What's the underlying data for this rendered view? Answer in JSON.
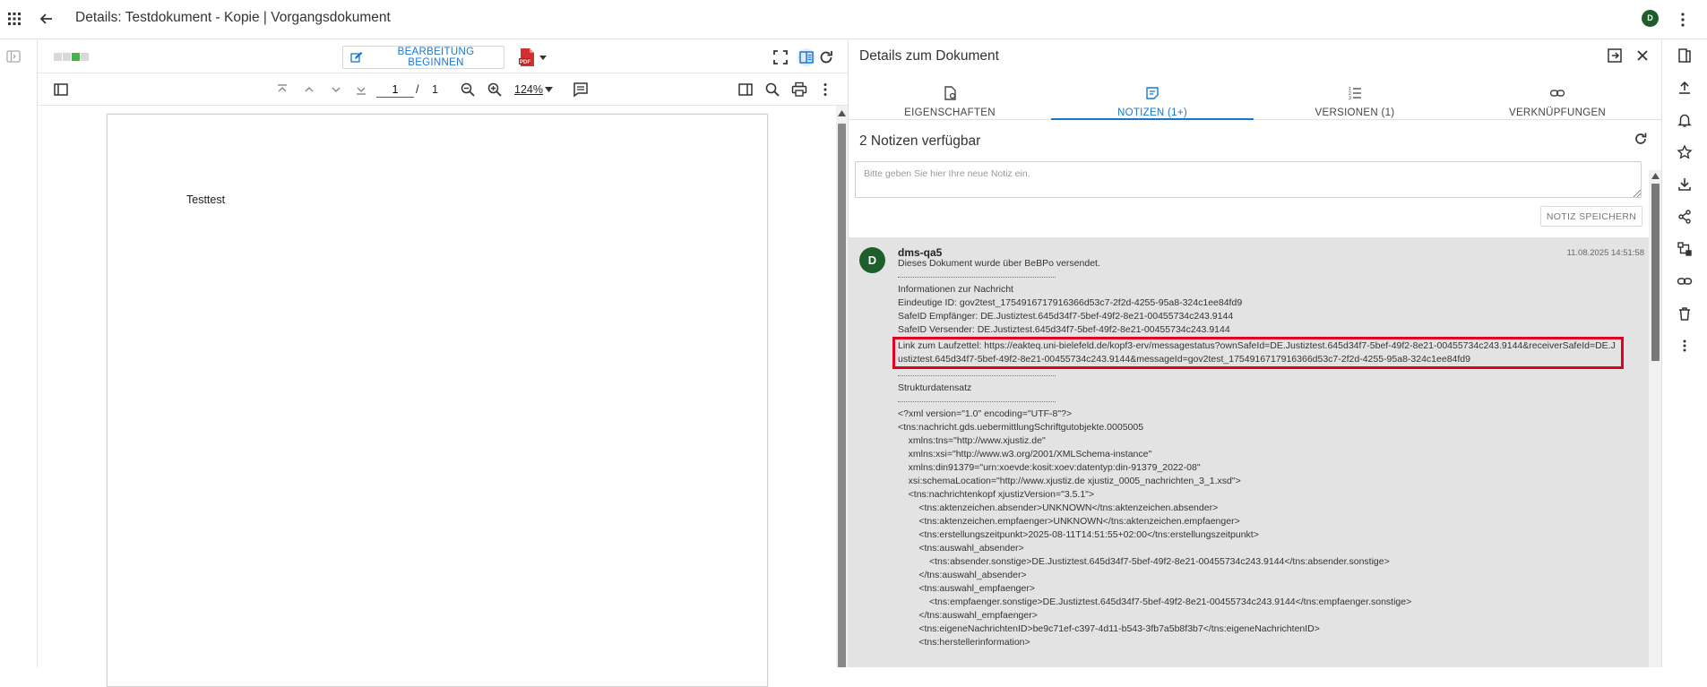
{
  "header": {
    "title": "Details: Testdokument - Kopie | Vorgangsdokument",
    "user_initial": "D"
  },
  "viewer": {
    "edit_button_label": "BEARBEITUNG BEGINNEN",
    "page_current": "1",
    "page_separator": "/",
    "page_total": "1",
    "zoom": "124%",
    "document_text": "Testtest",
    "progress_steps": [
      "pending",
      "pending",
      "done",
      "pending"
    ]
  },
  "details": {
    "title": "Details zum Dokument",
    "tabs": [
      {
        "label": "EIGENSCHAFTEN",
        "icon": "file-settings-icon"
      },
      {
        "label": "NOTIZEN (1+)",
        "icon": "note-icon"
      },
      {
        "label": "VERSIONEN (1)",
        "icon": "list-numbered-icon"
      },
      {
        "label": "VERKNÜPFUNGEN",
        "icon": "link-icon"
      }
    ],
    "active_tab": 1,
    "notes_count": "2 Notizen verfügbar",
    "note_placeholder": "Bitte geben Sie hier Ihre neue Notiz ein.",
    "save_note_label": "NOTIZ SPEICHERN",
    "note": {
      "author": "dms-qa5",
      "author_initial": "D",
      "date": "11.08.2025 14:51:58",
      "lines": {
        "intro": "Dieses Dokument wurde über BeBPo versendet.",
        "info_heading": "Informationen zur Nachricht",
        "id": "Eindeutige ID: gov2test_1754916717916366d53c7-2f2d-4255-95a8-324c1ee84fd9",
        "safeid_receiver": "SafeID Empfänger: DE.Justiztest.645d34f7-5bef-49f2-8e21-00455734c243.9144",
        "safeid_sender": "SafeID Versender: DE.Justiztest.645d34f7-5bef-49f2-8e21-00455734c243.9144",
        "link": "Link zum Laufzettel: https://eakteq.uni-bielefeld.de/kopf3-erv/messagestatus?ownSafeId=DE.Justiztest.645d34f7-5bef-49f2-8e21-00455734c243.9144&receiverSafeId=DE.Justiztest.645d34f7-5bef-49f2-8e21-00455734c243.9144&messageId=gov2test_1754916717916366d53c7-2f2d-4255-95a8-324c1ee84fd9",
        "struct_heading": "Strukturdatensatz",
        "xml": [
          "<?xml version=\"1.0\" encoding=\"UTF-8\"?>",
          "<tns:nachricht.gds.uebermittlungSchriftgutobjekte.0005005",
          "    xmlns:tns=\"http://www.xjustiz.de\"",
          "    xmlns:xsi=\"http://www.w3.org/2001/XMLSchema-instance\"",
          "    xmlns:din91379=\"urn:xoevde:kosit:xoev:datentyp:din-91379_2022-08\"",
          "    xsi:schemaLocation=\"http://www.xjustiz.de xjustiz_0005_nachrichten_3_1.xsd\">",
          "    <tns:nachrichtenkopf xjustizVersion=\"3.5.1\">",
          "        <tns:aktenzeichen.absender>UNKNOWN</tns:aktenzeichen.absender>",
          "        <tns:aktenzeichen.empfaenger>UNKNOWN</tns:aktenzeichen.empfaenger>",
          "        <tns:erstellungszeitpunkt>2025-08-11T14:51:55+02:00</tns:erstellungszeitpunkt>",
          "        <tns:auswahl_absender>",
          "            <tns:absender.sonstige>DE.Justiztest.645d34f7-5bef-49f2-8e21-00455734c243.9144</tns:absender.sonstige>",
          "        </tns:auswahl_absender>",
          "        <tns:auswahl_empfaenger>",
          "            <tns:empfaenger.sonstige>DE.Justiztest.645d34f7-5bef-49f2-8e21-00455734c243.9144</tns:empfaenger.sonstige>",
          "        </tns:auswahl_empfaenger>",
          "        <tns:eigeneNachrichtenID>be9c71ef-c397-4d11-b543-3fb7a5b8f3b7</tns:eigeneNachrichtenID>",
          "        <tns:herstellerinformation>"
        ]
      }
    }
  },
  "colors": {
    "accent": "#1976d2",
    "avatar": "#1e5e2a",
    "highlight": "#e00020",
    "progress_done": "#4caf50",
    "pdf": "#d32f2f"
  }
}
